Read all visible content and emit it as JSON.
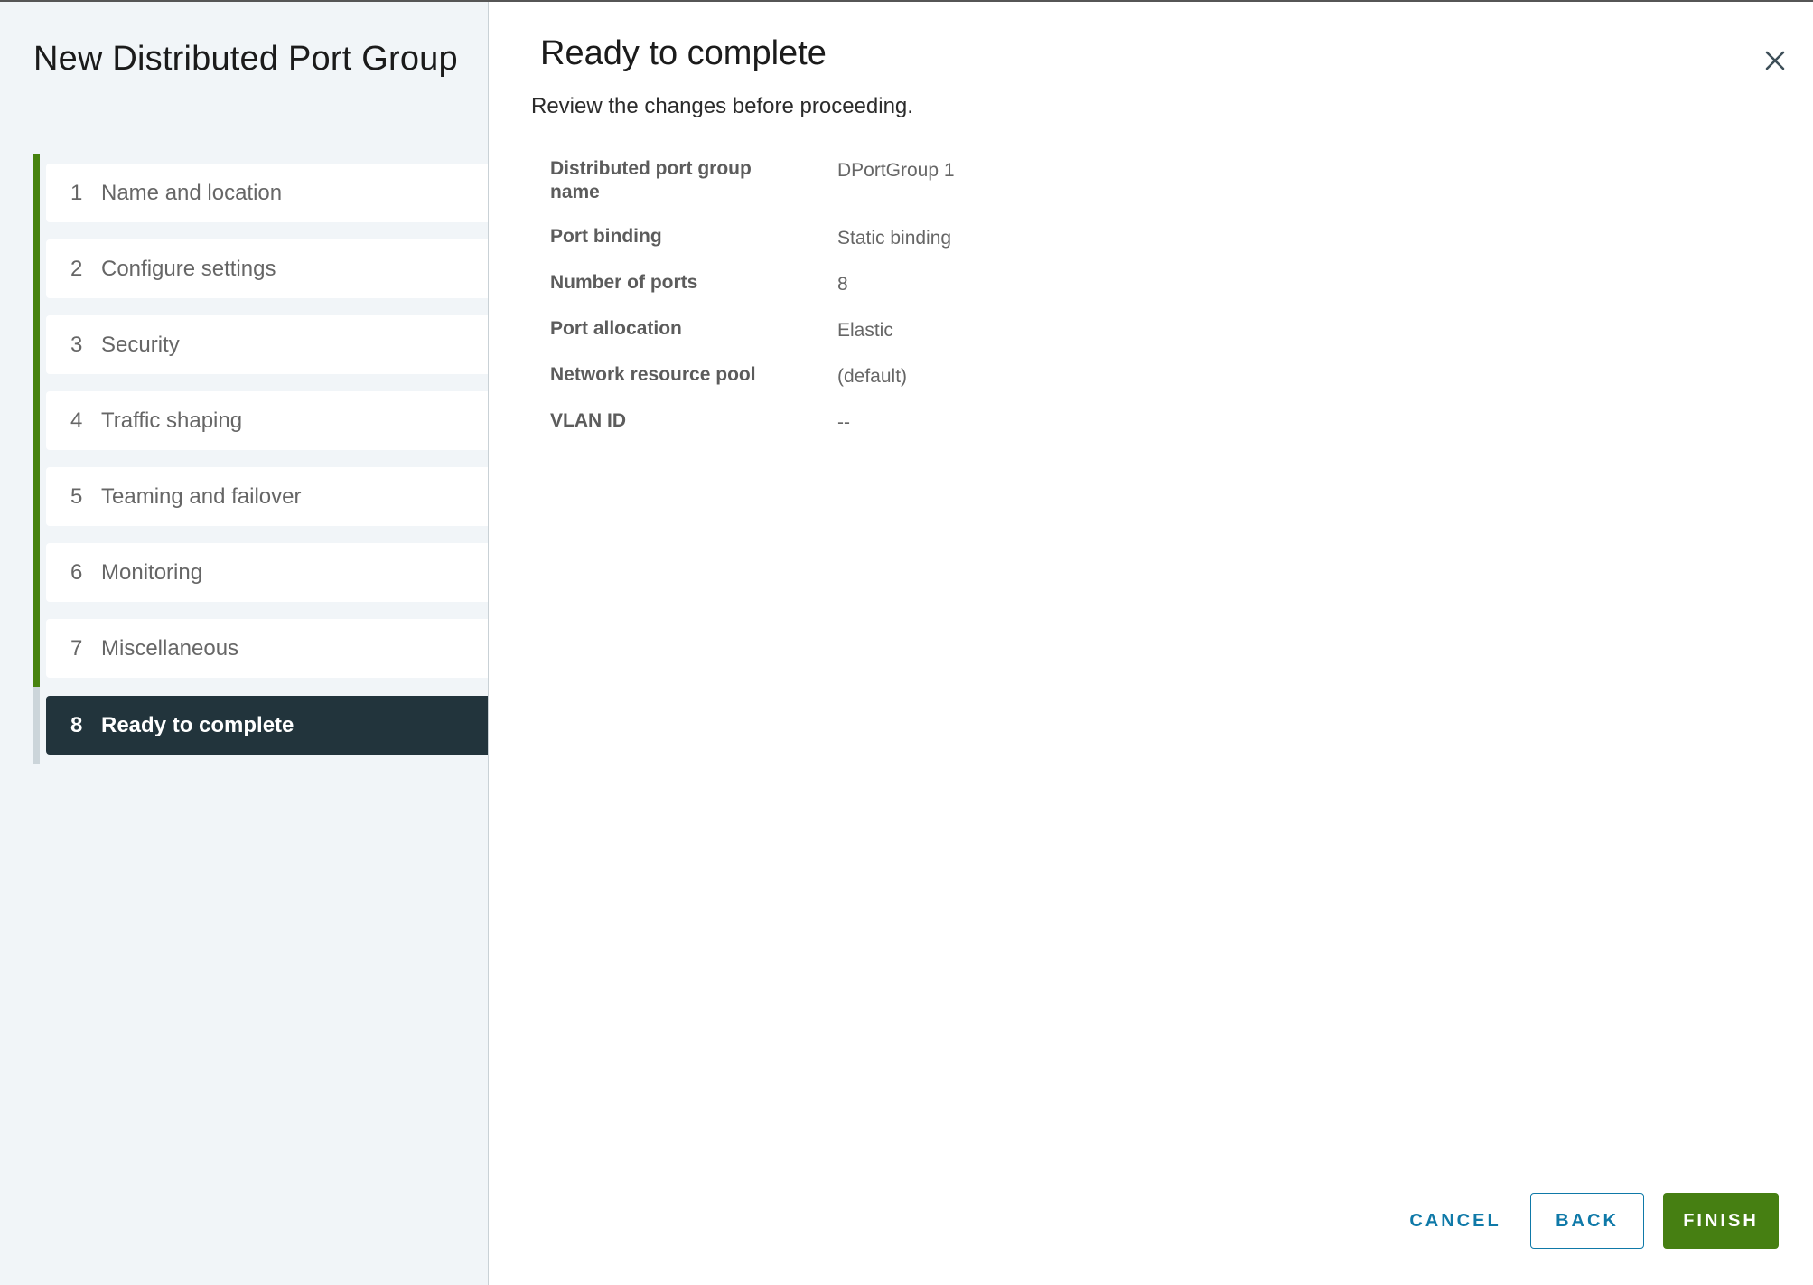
{
  "wizard": {
    "title": "New Distributed Port Group",
    "steps": [
      {
        "number": "1",
        "label": "Name and location",
        "state": "completed"
      },
      {
        "number": "2",
        "label": "Configure settings",
        "state": "completed"
      },
      {
        "number": "3",
        "label": "Security",
        "state": "completed"
      },
      {
        "number": "4",
        "label": "Traffic shaping",
        "state": "completed"
      },
      {
        "number": "5",
        "label": "Teaming and failover",
        "state": "completed"
      },
      {
        "number": "6",
        "label": "Monitoring",
        "state": "completed"
      },
      {
        "number": "7",
        "label": "Miscellaneous",
        "state": "completed"
      },
      {
        "number": "8",
        "label": "Ready to complete",
        "state": "active"
      }
    ]
  },
  "main": {
    "title": "Ready to complete",
    "subtitle": "Review the changes before proceeding.",
    "close_icon": "close-icon",
    "summary": [
      {
        "label": "Distributed port group name",
        "value": "DPortGroup 1"
      },
      {
        "label": "Port binding",
        "value": "Static binding"
      },
      {
        "label": "Number of ports",
        "value": "8"
      },
      {
        "label": "Port allocation",
        "value": "Elastic"
      },
      {
        "label": "Network resource pool",
        "value": "(default)"
      },
      {
        "label": "VLAN ID",
        "value": "--"
      }
    ]
  },
  "footer": {
    "cancel_label": "CANCEL",
    "back_label": "BACK",
    "finish_label": "FINISH"
  },
  "colors": {
    "accent_green": "#467f12",
    "progress_green": "#47830f",
    "link_blue": "#0f79a8",
    "active_step_bg": "#22343c",
    "sidebar_bg": "#f1f5f8"
  }
}
